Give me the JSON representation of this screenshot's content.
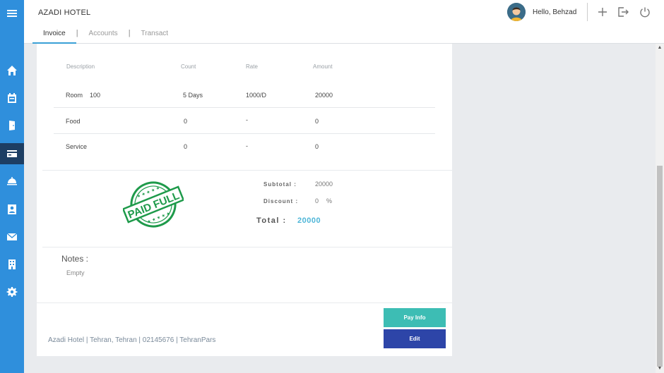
{
  "app": {
    "title": "AZADI HOTEL"
  },
  "tabs": [
    {
      "label": "Invoice"
    },
    {
      "label": "Accounts"
    },
    {
      "label": "Transact"
    }
  ],
  "user": {
    "greeting": "Hello, Behzad"
  },
  "invoice": {
    "headers": {
      "description": "Description",
      "count": "Count",
      "rate": "Rate",
      "amount": "Amount"
    },
    "rows": [
      {
        "description": "Room",
        "extra": "100",
        "count": "5 Days",
        "rate": "1000/D",
        "amount": "20000"
      },
      {
        "description": "Food",
        "extra": "",
        "count": "0",
        "rate": "-",
        "amount": "0"
      },
      {
        "description": "Service",
        "extra": "",
        "count": "0",
        "rate": "-",
        "amount": "0"
      }
    ],
    "stamp_text": "PAID FULL",
    "subtotal_label": "Subtotal :",
    "subtotal_value": "20000",
    "discount_label": "Discount :",
    "discount_value": "0",
    "discount_unit": "%",
    "total_label": "Total :",
    "total_value": "20000"
  },
  "notes": {
    "title": "Notes :",
    "value": "Empty"
  },
  "footer": {
    "text": "Azadi Hotel | Tehran, Tehran | 02145676 | TehranPars"
  },
  "buttons": {
    "pay_info": "Pay Info",
    "edit": "Edit"
  },
  "colors": {
    "sidebar": "#2f8fdc",
    "sidebar_active": "#1d3e63",
    "pay_button": "#3dbdb4",
    "edit_button": "#2d45a8",
    "stamp": "#1e9a4a",
    "total": "#4fb6d8"
  },
  "icons": [
    "menu-icon",
    "home-icon",
    "calendar-icon",
    "door-icon",
    "card-icon",
    "room-service-icon",
    "contact-icon",
    "mail-icon",
    "building-icon",
    "gear-icon",
    "plus-icon",
    "logout-icon",
    "power-icon"
  ]
}
